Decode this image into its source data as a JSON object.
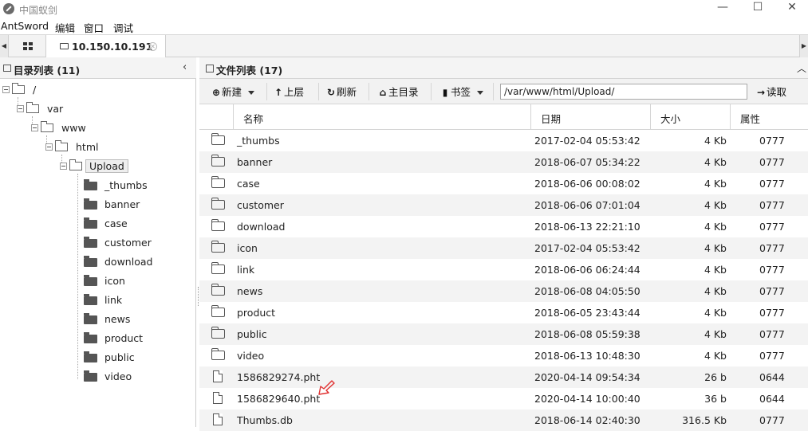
{
  "window": {
    "title": "中国蚁剑",
    "minimize": "—",
    "maximize": "☐",
    "close": "✕"
  },
  "menu": [
    "AntSword",
    "编辑",
    "窗口",
    "调试"
  ],
  "tabs": {
    "left_arrow": "◀",
    "right_arrow": "▶",
    "active_label": "10.150.10.191",
    "close_glyph": "✕"
  },
  "left_panel": {
    "title": "目录列表 (11)",
    "collapse": "‹",
    "tree": [
      {
        "label": "/",
        "level": 0
      },
      {
        "label": "var",
        "level": 1
      },
      {
        "label": "www",
        "level": 2
      },
      {
        "label": "html",
        "level": 3
      },
      {
        "label": "Upload",
        "level": 4,
        "selected": true
      }
    ],
    "children": [
      "_thumbs",
      "banner",
      "case",
      "customer",
      "download",
      "icon",
      "link",
      "news",
      "product",
      "public",
      "video"
    ]
  },
  "right_panel": {
    "title": "文件列表 (17)",
    "up": "︿",
    "toolbar": {
      "new_label": "新建",
      "up_label": "上层",
      "refresh_label": "刷新",
      "home_label": "主目录",
      "bookmark_label": "书签",
      "path": "/var/www/html/Upload/",
      "read_label": "读取"
    },
    "columns": [
      "名称",
      "日期",
      "大小",
      "属性"
    ],
    "files": [
      {
        "type": "folder",
        "name": "_thumbs",
        "date": "2017-02-04 05:53:42",
        "size": "4 Kb",
        "perm": "0777"
      },
      {
        "type": "folder",
        "name": "banner",
        "date": "2018-06-07 05:34:22",
        "size": "4 Kb",
        "perm": "0777"
      },
      {
        "type": "folder",
        "name": "case",
        "date": "2018-06-06 00:08:02",
        "size": "4 Kb",
        "perm": "0777"
      },
      {
        "type": "folder",
        "name": "customer",
        "date": "2018-06-06 07:01:04",
        "size": "4 Kb",
        "perm": "0777"
      },
      {
        "type": "folder",
        "name": "download",
        "date": "2018-06-13 22:21:10",
        "size": "4 Kb",
        "perm": "0777"
      },
      {
        "type": "folder",
        "name": "icon",
        "date": "2017-02-04 05:53:42",
        "size": "4 Kb",
        "perm": "0777"
      },
      {
        "type": "folder",
        "name": "link",
        "date": "2018-06-06 06:24:44",
        "size": "4 Kb",
        "perm": "0777"
      },
      {
        "type": "folder",
        "name": "news",
        "date": "2018-06-08 04:05:50",
        "size": "4 Kb",
        "perm": "0777"
      },
      {
        "type": "folder",
        "name": "product",
        "date": "2018-06-05 23:43:44",
        "size": "4 Kb",
        "perm": "0777"
      },
      {
        "type": "folder",
        "name": "public",
        "date": "2018-06-08 05:59:38",
        "size": "4 Kb",
        "perm": "0777"
      },
      {
        "type": "folder",
        "name": "video",
        "date": "2018-06-13 10:48:30",
        "size": "4 Kb",
        "perm": "0777"
      },
      {
        "type": "file",
        "name": "1586829274.pht",
        "date": "2020-04-14 09:54:34",
        "size": "26 b",
        "perm": "0644"
      },
      {
        "type": "file",
        "name": "1586829640.pht",
        "date": "2020-04-14 10:00:40",
        "size": "36 b",
        "perm": "0644"
      },
      {
        "type": "file",
        "name": "Thumbs.db",
        "date": "2018-06-14 02:40:30",
        "size": "316.5 Kb",
        "perm": "0777"
      }
    ]
  },
  "colors": {
    "annotation_arrow": "#e03030",
    "header_bg": "#f4f4f4",
    "alt_row_bg": "#f3f3f3"
  }
}
